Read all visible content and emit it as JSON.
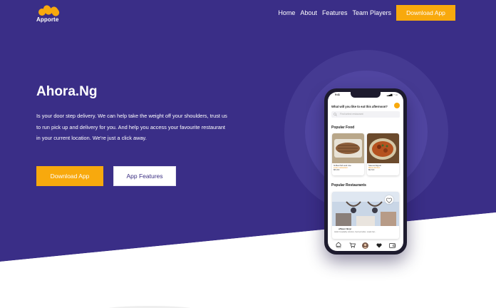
{
  "brand": {
    "name": "Apporte",
    "primary_color": "#3a2e87",
    "accent_color": "#f8a90d"
  },
  "nav": {
    "links": [
      "Home",
      "About",
      "Features",
      "Team Players"
    ],
    "cta_label": "Download App"
  },
  "hero": {
    "title": "Ahora.Ng",
    "description": "Is your door step delivery. We can help take the weight off your shoulders, trust us to run pick up and delivery for you. And help you access your favourite restaurant in your current location. We're just a click away.",
    "primary_button": "Download App",
    "secondary_button": "App Features"
  },
  "phone": {
    "status_time": "9:41",
    "status_icons": "▂▄▆ ◔ ▭",
    "question": "What will you like to eat this afternoon?",
    "search_placeholder": "Find select restaurant",
    "popular_food_heading": "Popular Food",
    "foods": [
      {
        "name": "Grilled fish and rice",
        "sub": "Lorem restaurant",
        "price": "₦5,000",
        "icon": "food-grilled-image"
      },
      {
        "name": "Sauced Egusi",
        "sub": "Mama kitchen",
        "price": "₦4,500",
        "icon": "food-stew-image"
      }
    ],
    "popular_restaurants_heading": "Popular Restaurants",
    "restaurant": {
      "name": "uTauer Ikoyi",
      "desc": "Hello hospitality solution, food provider, snack bar..."
    },
    "tabs": [
      {
        "icon": "home-icon",
        "label": "Home"
      },
      {
        "icon": "cart-icon",
        "label": ""
      },
      {
        "icon": "profile-icon",
        "label": ""
      },
      {
        "icon": "heart-icon",
        "label": ""
      },
      {
        "icon": "wallet-icon",
        "label": ""
      }
    ]
  }
}
